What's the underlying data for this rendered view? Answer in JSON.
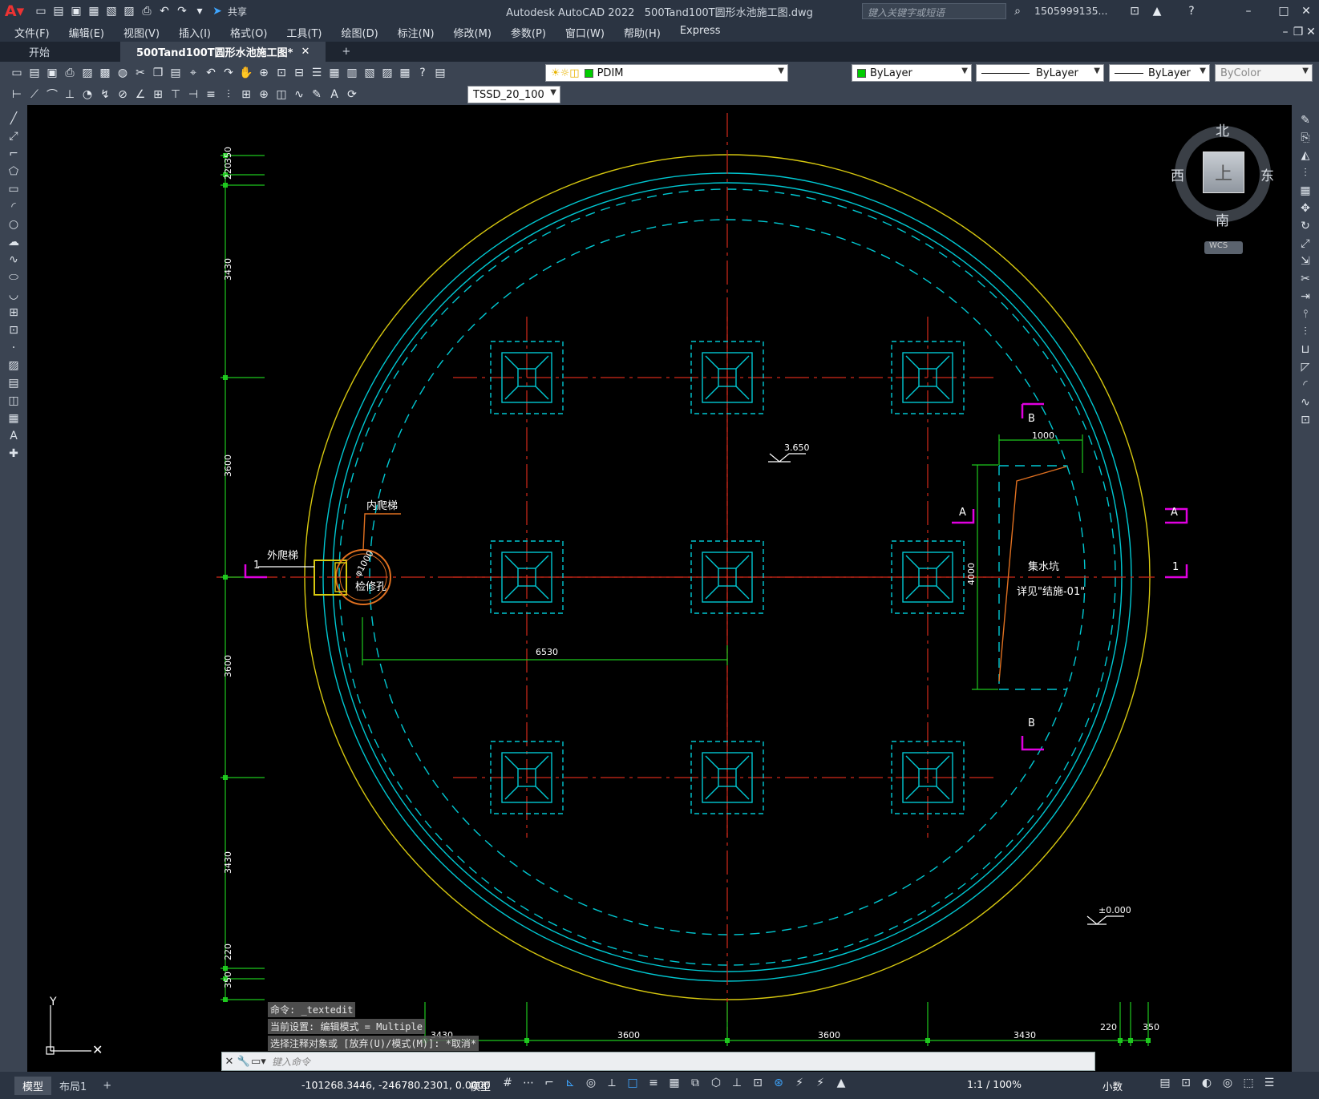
{
  "app": {
    "title": "Autodesk AutoCAD 2022",
    "file": "500Tand100T圆形水池施工图.dwg",
    "search_placeholder": "键入关键字或短语",
    "user": "1505999135...",
    "share": "共享"
  },
  "menu": [
    "文件(F)",
    "编辑(E)",
    "视图(V)",
    "插入(I)",
    "格式(O)",
    "工具(T)",
    "绘图(D)",
    "标注(N)",
    "修改(M)",
    "参数(P)",
    "窗口(W)",
    "帮助(H)",
    "Express"
  ],
  "tabs": [
    {
      "label": "开始"
    },
    {
      "label": "500Tand100T圆形水池施工图*"
    },
    {
      "label": "+"
    }
  ],
  "properties": {
    "layer": "PDIM",
    "color": "ByLayer",
    "linetype": "ByLayer",
    "lineweight": "ByLayer",
    "plotstyle": "ByColor",
    "dimstyle": "TSSD_20_100"
  },
  "viewcube": {
    "n": "北",
    "s": "南",
    "e": "东",
    "w": "西",
    "face": "上",
    "wcs": "WCS"
  },
  "drawing_text": {
    "ladder_inner": "内爬梯",
    "ladder_outer": "外爬梯",
    "hatch": "检修孔",
    "phi": "φ1000",
    "sump": "集水坑",
    "sump_ref": "详见\"结施-01\"",
    "elev_top": "3.650",
    "elev_zero": "±0.000",
    "sec_b": "B",
    "sec_a": "A",
    "sec_1": "1",
    "dim_1000": "1000",
    "dim_4000": "4000",
    "dim_6530": "6530",
    "left_dims": [
      "350",
      "220",
      "3430",
      "3600",
      "3600",
      "3430",
      "220",
      "350"
    ],
    "bottom_dims": [
      "3430",
      "3600",
      "3600",
      "3430",
      "220",
      "350"
    ],
    "bottom_hidden": "220"
  },
  "command": {
    "history": [
      "命令: _textedit",
      "当前设置: 编辑模式 = Multiple",
      "选择注释对象或 [放弃(U)/模式(M)]: *取消*"
    ],
    "placeholder": "键入命令"
  },
  "status": {
    "tabs": [
      "模型",
      "布局1",
      "+"
    ],
    "coords": "-101268.3446, -246780.2301, 0.0000",
    "space": "模型",
    "scale": "1:1 / 100%",
    "units": "小数"
  },
  "colors": {
    "yellow": "#d7c80f",
    "cyan": "#00c8d2",
    "red": "#d22",
    "green": "#1ec81e",
    "magenta": "#e000e0",
    "orange": "#e07020",
    "white": "#ffffff"
  }
}
